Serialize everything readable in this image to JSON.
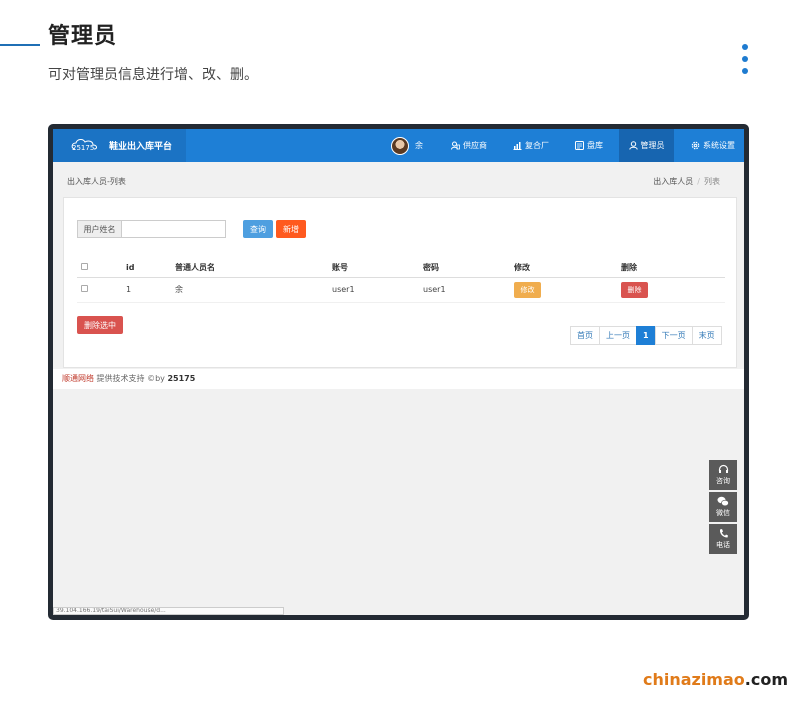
{
  "slide": {
    "title": "管理员",
    "subtitle": "可对管理员信息进行增、改、删。"
  },
  "app": {
    "brand_logo": "25175",
    "brand_name": "鞋业出入库平台",
    "user_name": "余",
    "nav": [
      {
        "label": "供应商",
        "icon": "supplier-icon"
      },
      {
        "label": "复合厂",
        "icon": "chart-icon"
      },
      {
        "label": "盘库",
        "icon": "inventory-icon"
      },
      {
        "label": "管理员",
        "icon": "user-icon",
        "active": true
      },
      {
        "label": "系统设置",
        "icon": "gear-icon"
      }
    ],
    "accent_color": "#1e7fd6"
  },
  "breadcrumb": {
    "left": "出入库人员-列表",
    "right_parent": "出入库人员",
    "right_separator": "/",
    "right_current": "列表"
  },
  "search": {
    "label": "用户姓名",
    "value": "",
    "query_label": "查询",
    "add_label": "新增"
  },
  "table": {
    "headers": [
      "id",
      "普通人员名",
      "账号",
      "密码",
      "修改",
      "删除"
    ],
    "rows": [
      {
        "id": "1",
        "name": "余",
        "account": "user1",
        "password": "user1",
        "edit": "修改",
        "delete": "删除"
      }
    ]
  },
  "batch_delete_label": "删除选中",
  "pager": {
    "first": "首页",
    "prev": "上一页",
    "current": "1",
    "next": "下一页",
    "last": "末页"
  },
  "footer": {
    "company": "顺通网络",
    "text": "提供技术支持 ©by",
    "brand": "25175"
  },
  "side_tools": [
    {
      "label": "咨询",
      "icon": "headset-icon"
    },
    {
      "label": "微信",
      "icon": "wechat-icon"
    },
    {
      "label": "电话",
      "icon": "phone-icon"
    }
  ],
  "status_url": "39.104.166.19/taiSui/Warehouse/d...",
  "watermark": {
    "part1": "chinazimao",
    "part2": ".com"
  }
}
